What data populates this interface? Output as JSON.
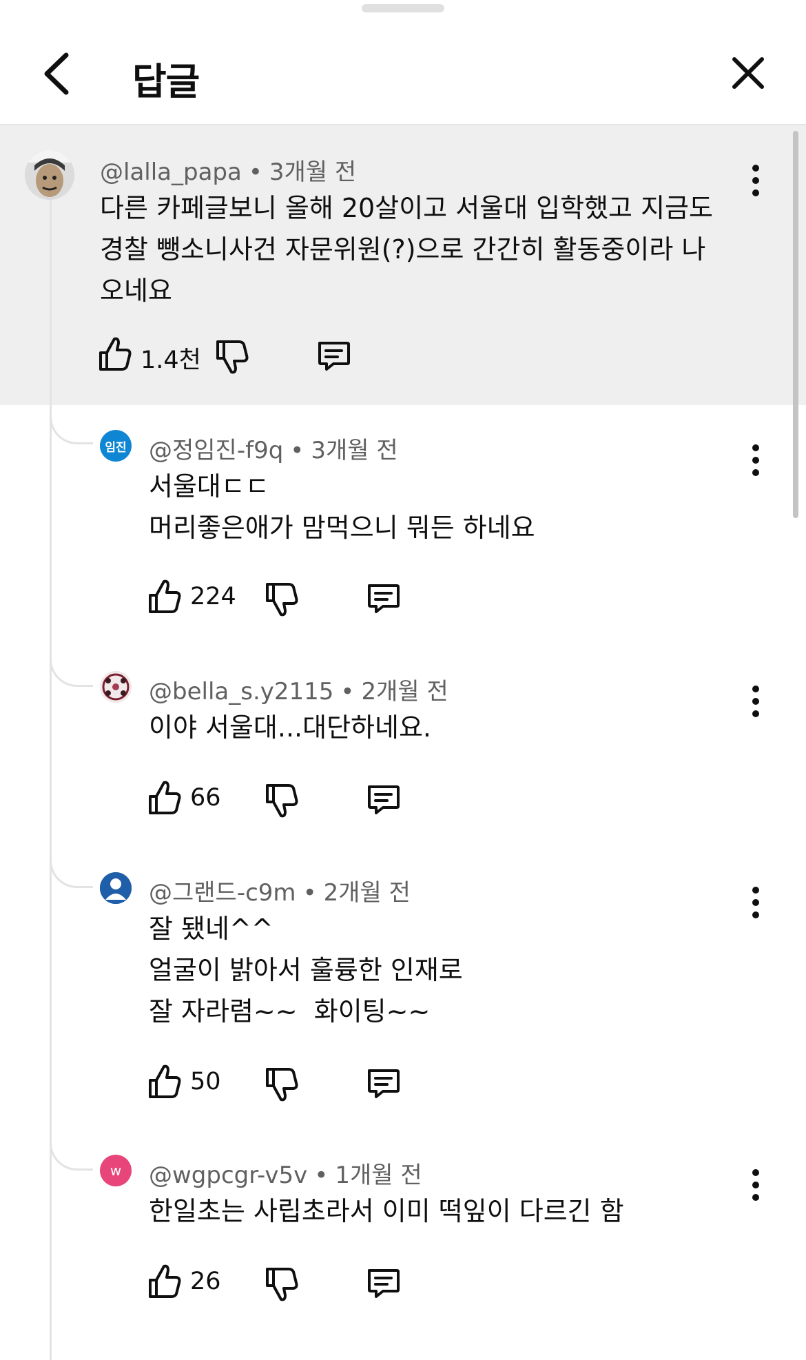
{
  "header": {
    "title": "답글",
    "back_icon": "chevron-left-icon",
    "close_icon": "close-icon"
  },
  "parent_comment": {
    "author": "@lalla_papa",
    "time": "3개월 전",
    "lines": [
      "다른 카페글보니 올해 20살이고 서울대 입학했고 지금도",
      "경찰 뺑소니사건 자문위원(?)으로 간간히 활동중이라 나",
      "오네요"
    ],
    "likes": "1.4천"
  },
  "replies": [
    {
      "author": "@정임진-f9q",
      "time": "3개월 전",
      "avatar_text": "임진",
      "avatar_color": "#0f86d4",
      "lines": [
        "서울대ㄷㄷ",
        "머리좋은애가 맘먹으니 뭐든 하네요"
      ],
      "likes": "224"
    },
    {
      "author": "@bella_s.y2115",
      "time": "2개월 전",
      "avatar_text": "",
      "avatar_color": "#d9c9cc",
      "lines": [
        "이야 서울대...대단하네요."
      ],
      "likes": "66"
    },
    {
      "author": "@그랜드-c9m",
      "time": "2개월 전",
      "avatar_text": "",
      "avatar_color": "#1f5ea8",
      "lines": [
        "잘 됐네^^",
        "얼굴이 밝아서 훌륭한 인재로",
        "잘 자라렴~~  화이팅~~"
      ],
      "likes": "50"
    },
    {
      "author": "@wgpcgr-v5v",
      "time": "1개월 전",
      "avatar_text": "w",
      "avatar_color": "#e8457a",
      "lines": [
        "한일초는 사립초라서 이미 떡잎이 다르긴 함"
      ],
      "likes": "26"
    }
  ]
}
